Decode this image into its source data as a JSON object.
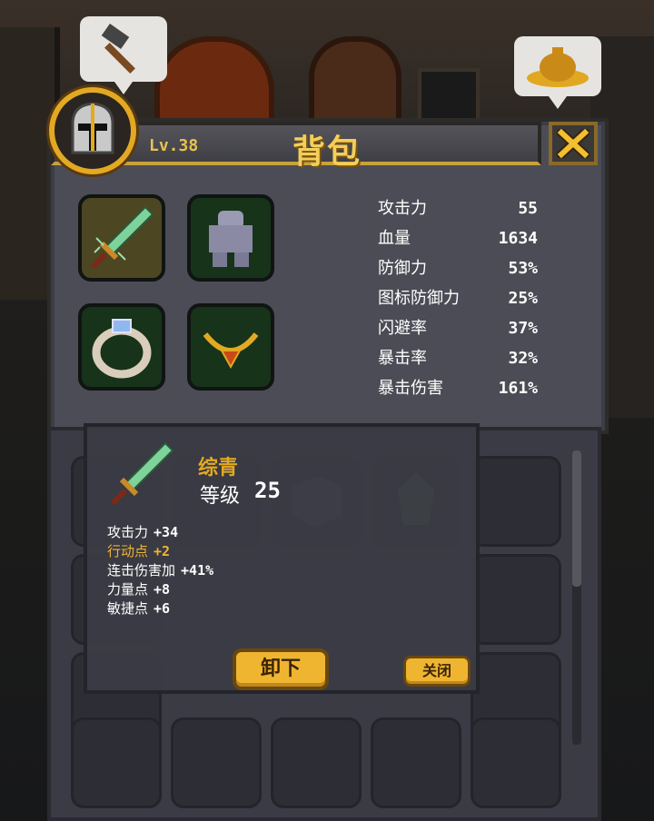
{
  "header": {
    "level": "Lv.38",
    "title": "背包"
  },
  "stats": [
    {
      "label": "攻击力",
      "value": "55"
    },
    {
      "label": "血量",
      "value": "1634"
    },
    {
      "label": "防御力",
      "value": "53%"
    },
    {
      "label": "图标防御力",
      "value": "25%"
    },
    {
      "label": "闪避率",
      "value": "37%"
    },
    {
      "label": "暴击率",
      "value": "32%"
    },
    {
      "label": "暴击伤害",
      "value": "161%"
    }
  ],
  "tooltip": {
    "item_name": "综青",
    "level_label": "等级",
    "level_value": "25",
    "attributes": [
      {
        "label": "攻击力",
        "value": "+34"
      },
      {
        "label": "行动点",
        "value": "+2"
      },
      {
        "label": "连击伤害加",
        "value": "+41%"
      },
      {
        "label": "力量点",
        "value": "+8"
      },
      {
        "label": "敏捷点",
        "value": "+6"
      }
    ],
    "unequip_label": "卸下",
    "close_label": "关闭"
  },
  "colors": {
    "accent_gold": "#f0b530",
    "highlight_stat": "#f0b430",
    "slot_green": "#17331a"
  }
}
